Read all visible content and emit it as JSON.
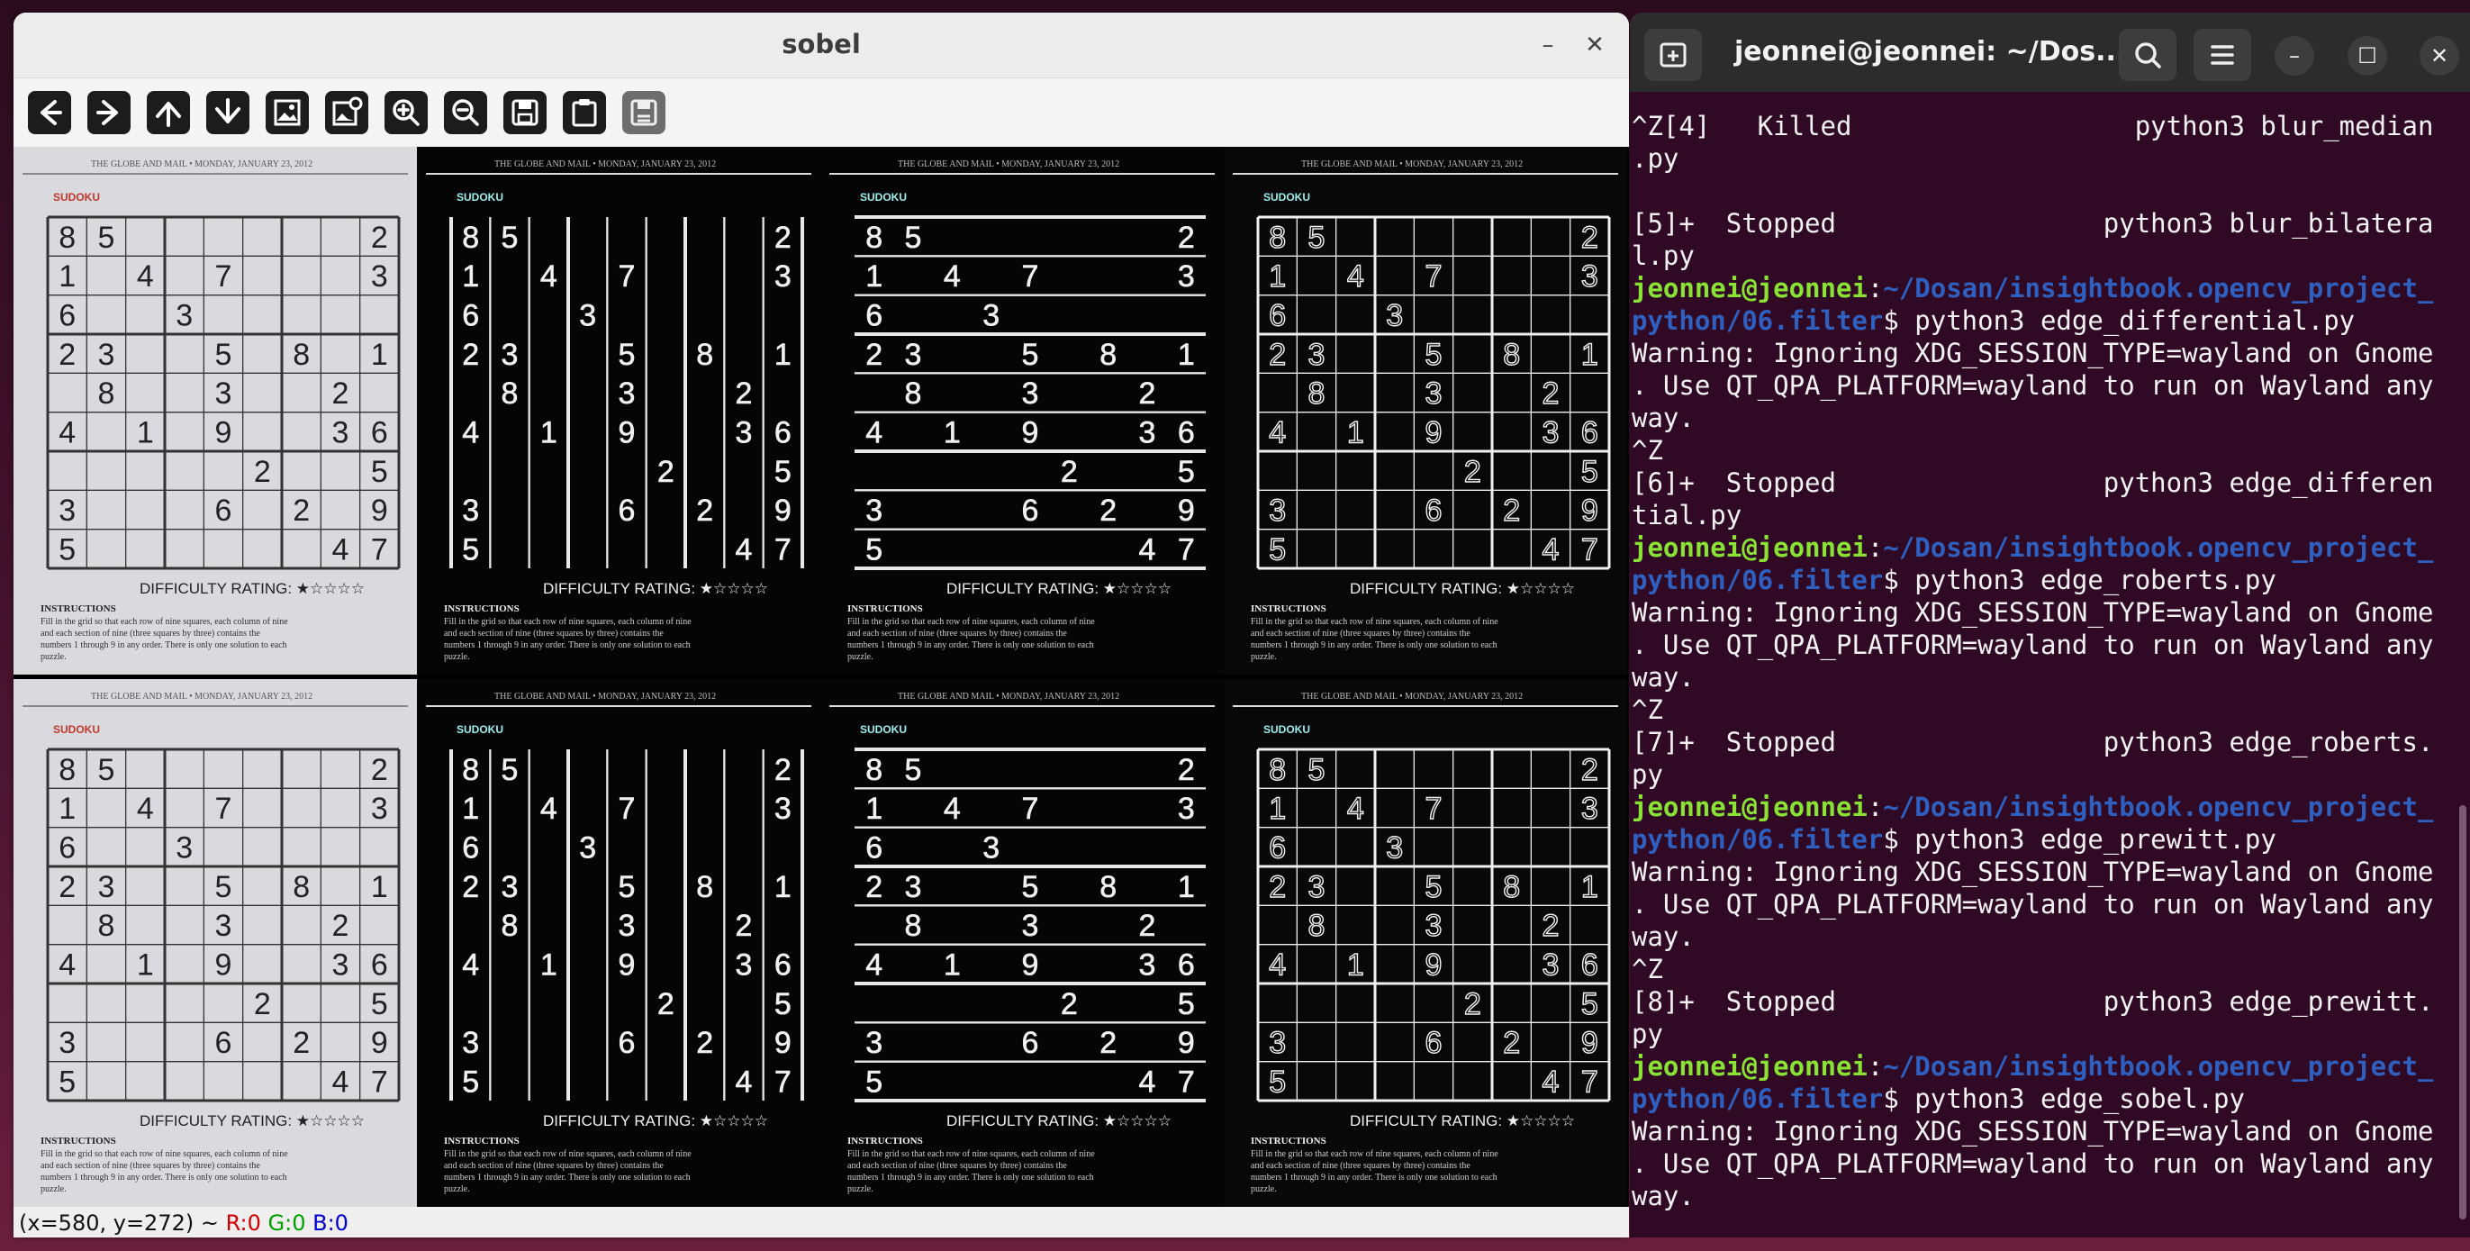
{
  "viewer": {
    "title": "sobel",
    "minimize": "–",
    "close": "✕",
    "toolbar": [
      {
        "name": "pan-left-icon"
      },
      {
        "name": "pan-right-icon"
      },
      {
        "name": "pan-up-icon"
      },
      {
        "name": "pan-down-icon"
      },
      {
        "name": "zoom-original-icon"
      },
      {
        "name": "zoom-fit-icon"
      },
      {
        "name": "zoom-in-icon"
      },
      {
        "name": "zoom-out-icon"
      },
      {
        "name": "save-icon"
      },
      {
        "name": "copy-clipboard-icon"
      },
      {
        "name": "properties-icon"
      }
    ],
    "sudoku": {
      "header": "THE GLOBE AND MAIL  •  MONDAY, JANUARY 23, 2012",
      "brand": "SUDOKU",
      "grid": [
        [
          "8",
          "5",
          "",
          "",
          "",
          "",
          "",
          "",
          "2"
        ],
        [
          "1",
          "",
          "4",
          "",
          "7",
          "",
          "",
          "",
          "3"
        ],
        [
          "6",
          "",
          "",
          "3",
          "",
          "",
          "",
          "",
          ""
        ],
        [
          "2",
          "3",
          "",
          "",
          "5",
          "",
          "8",
          "",
          "1"
        ],
        [
          "",
          "8",
          "",
          "",
          "3",
          "",
          "",
          "2",
          ""
        ],
        [
          "4",
          "",
          "1",
          "",
          "9",
          "",
          "",
          "3",
          "6"
        ],
        [
          "",
          "",
          "",
          "",
          "",
          "2",
          "",
          "",
          "5"
        ],
        [
          "3",
          "",
          "",
          "",
          "6",
          "",
          "2",
          "",
          "9"
        ],
        [
          "5",
          "",
          "",
          "",
          "",
          "",
          "",
          "4",
          "7"
        ]
      ],
      "rating_label": "DIFFICULTY RATING: ★☆☆☆☆",
      "instructions_title": "INSTRUCTIONS",
      "instructions": [
        "Fill in the grid so that each row of nine squares, each column of nine",
        "and each section of nine (three squares by three) contains the",
        "numbers 1 through 9 in any order. There is only one solution to each",
        "puzzle."
      ]
    },
    "status": {
      "coords": "(x=580, y=272) ~ ",
      "r": "R:0",
      "g": "G:0",
      "b": "B:0"
    }
  },
  "terminal": {
    "title": "jeonnei@jeonnei: ~/Dos...",
    "lines": [
      {
        "t": "^Z[4]   Killed                  python3 blur_median"
      },
      {
        "t": ".py"
      },
      {
        "t": ""
      },
      {
        "t": "[5]+  Stopped                 python3 blur_bilatera"
      },
      {
        "t": "l.py"
      },
      {
        "user": "jeonnei@jeonnei",
        "path": "~/Dosan/insightbook.opencv_project_",
        "t": ""
      },
      {
        "path": "python/06.filter",
        "t": "$ python3 edge_differential.py"
      },
      {
        "t": "Warning: Ignoring XDG_SESSION_TYPE=wayland on Gnome"
      },
      {
        "t": ". Use QT_QPA_PLATFORM=wayland to run on Wayland any"
      },
      {
        "t": "way."
      },
      {
        "t": "^Z"
      },
      {
        "t": "[6]+  Stopped                 python3 edge_differen"
      },
      {
        "t": "tial.py"
      },
      {
        "user": "jeonnei@jeonnei",
        "path": "~/Dosan/insightbook.opencv_project_",
        "t": ""
      },
      {
        "path": "python/06.filter",
        "t": "$ python3 edge_roberts.py"
      },
      {
        "t": "Warning: Ignoring XDG_SESSION_TYPE=wayland on Gnome"
      },
      {
        "t": ". Use QT_QPA_PLATFORM=wayland to run on Wayland any"
      },
      {
        "t": "way."
      },
      {
        "t": "^Z"
      },
      {
        "t": "[7]+  Stopped                 python3 edge_roberts."
      },
      {
        "t": "py"
      },
      {
        "user": "jeonnei@jeonnei",
        "path": "~/Dosan/insightbook.opencv_project_",
        "t": ""
      },
      {
        "path": "python/06.filter",
        "t": "$ python3 edge_prewitt.py"
      },
      {
        "t": "Warning: Ignoring XDG_SESSION_TYPE=wayland on Gnome"
      },
      {
        "t": ". Use QT_QPA_PLATFORM=wayland to run on Wayland any"
      },
      {
        "t": "way."
      },
      {
        "t": "^Z"
      },
      {
        "t": "[8]+  Stopped                 python3 edge_prewitt."
      },
      {
        "t": "py"
      },
      {
        "user": "jeonnei@jeonnei",
        "path": "~/Dosan/insightbook.opencv_project_",
        "t": ""
      },
      {
        "path": "python/06.filter",
        "t": "$ python3 edge_sobel.py"
      },
      {
        "t": "Warning: Ignoring XDG_SESSION_TYPE=wayland on Gnome"
      },
      {
        "t": ". Use QT_QPA_PLATFORM=wayland to run on Wayland any"
      },
      {
        "t": "way."
      }
    ]
  },
  "colors": {
    "term_bg": "#300a24",
    "prompt_user": "#8ae234",
    "prompt_path": "#2f5fbf"
  }
}
